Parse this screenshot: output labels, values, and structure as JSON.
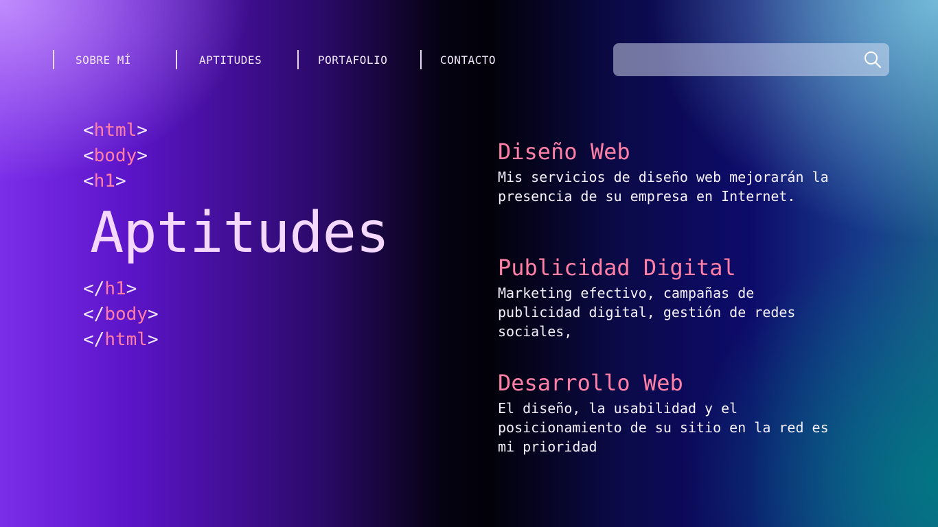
{
  "nav": {
    "items": [
      {
        "label": "SOBRE MÍ"
      },
      {
        "label": "APTITUDES"
      },
      {
        "label": "PORTAFOLIO"
      },
      {
        "label": "CONTACTO"
      }
    ]
  },
  "search": {
    "value": "",
    "placeholder": "",
    "icon": "search-icon"
  },
  "code": {
    "lt": "<",
    "gt": ">",
    "close_lt": "</",
    "html": "html",
    "body": "body",
    "h1": "h1"
  },
  "hero": {
    "title": "Aptitudes"
  },
  "skills": [
    {
      "title": "Diseño Web",
      "description": "Mis servicios de diseño web mejorarán la presencia de su empresa en Internet."
    },
    {
      "title": "Publicidad Digital",
      "description": "Marketing efectivo, campañas de publicidad digital, gestión de redes sociales,"
    },
    {
      "title": "Desarrollo Web",
      "description": "El diseño, la usabilidad y el posicionamiento de su sitio en la red es mi prioridad"
    }
  ],
  "colors": {
    "accent_pink": "#ff7fa7",
    "title_lilac": "#f4d8ff",
    "text_light": "#f5f0ff"
  }
}
